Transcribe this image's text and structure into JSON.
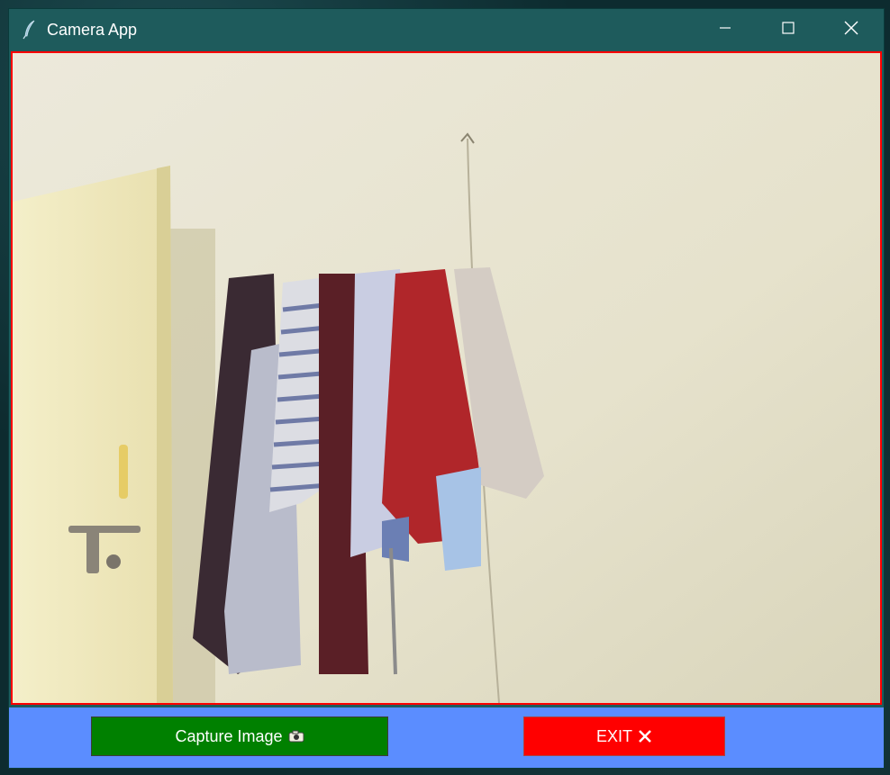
{
  "window": {
    "title": "Camera App",
    "app_icon": "feather-icon",
    "controls": [
      "minimize-icon",
      "maximize-icon",
      "close-icon"
    ]
  },
  "video": {
    "border_color": "#ff0000",
    "content": "camera-feed"
  },
  "buttons": {
    "capture_label": "Capture Image",
    "capture_icon": "camera-icon",
    "capture_color": "#008000",
    "exit_label": "EXIT",
    "exit_icon": "x-icon",
    "exit_color": "#ff0000"
  },
  "colors": {
    "titlebar": "#1e5b5c",
    "button_bar": "#5b8dff"
  }
}
